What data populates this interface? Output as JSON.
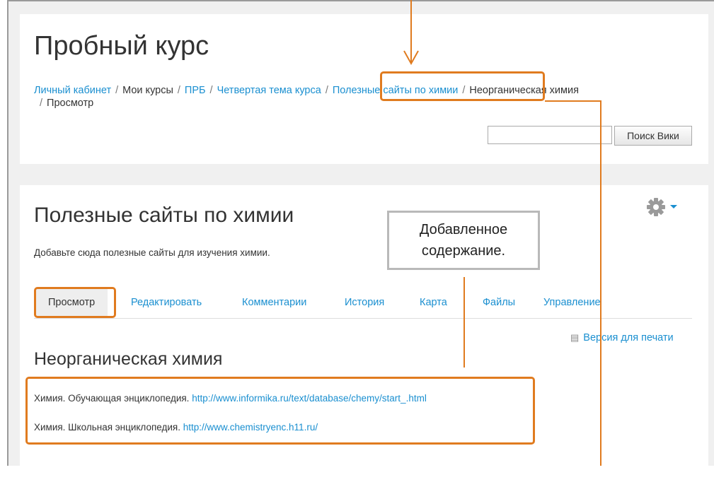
{
  "course": {
    "title": "Пробный курс"
  },
  "breadcrumb": {
    "items": [
      {
        "label": "Личный кабинет"
      },
      {
        "label": "Мои курсы"
      },
      {
        "label": "ПРБ"
      },
      {
        "label": "Четвертая тема курса"
      },
      {
        "label": "Полезные сайты по химии"
      },
      {
        "label": "Неорганическая химия"
      },
      {
        "label": "Просмотр"
      }
    ],
    "separator": "/"
  },
  "search": {
    "button_label": "Поиск Вики",
    "value": ""
  },
  "wiki": {
    "title": "Полезные сайты по химии",
    "description": "Добавьте сюда полезные сайты для изучения химии."
  },
  "tabs": [
    {
      "label": "Просмотр"
    },
    {
      "label": "Редактировать"
    },
    {
      "label": "Комментарии"
    },
    {
      "label": "История"
    },
    {
      "label": "Карта"
    },
    {
      "label": "Файлы"
    },
    {
      "label": "Управление"
    }
  ],
  "print": {
    "label": "Версия для печати"
  },
  "page": {
    "heading": "Неорганическая химия",
    "lines": [
      {
        "text": "Химия. Обучающая энциклопедия.",
        "url": "http://www.informika.ru/text/database/chemy/start_.html"
      },
      {
        "text": "Химия. Школьная энциклопедия.",
        "url": "http://www.chemistryenc.h11.ru/"
      }
    ]
  },
  "annotation": {
    "callout_line1": "Добавленное",
    "callout_line2": "содержание."
  },
  "colors": {
    "link": "#1a8fd0",
    "annotation": "#e07b1f"
  }
}
